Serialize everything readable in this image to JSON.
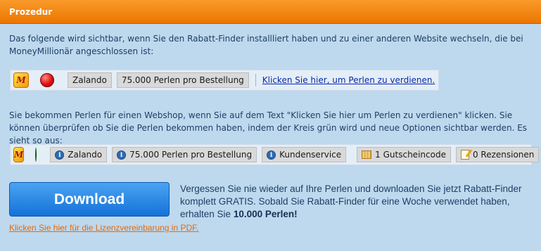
{
  "header": {
    "title": "Prozedur"
  },
  "intro_text": "Das folgende wird sichtbar, wenn Sie den Rabatt-Finder installliert haben und zu einer anderen Website wechseln, die bei MoneyMillionär angeschlossen ist:",
  "bar1": {
    "logo_text": "M",
    "status_color": "#e01010",
    "shop": "Zalando",
    "perlen": "75.000 Perlen pro Bestellung",
    "link": "Klicken Sie hier, um Perlen zu verdienen."
  },
  "explain_text": "Sie bekommen Perlen für einen Webshop, wenn Sie auf dem Text \"Klicken Sie hier um Perlen zu verdienen\" klicken. Sie können überprüfen ob Sie die Perlen bekommen haben, indem der Kreis grün wird und neue Optionen sichtbar werden. Es sieht so aus:",
  "bar2": {
    "logo_text": "M",
    "status_color": "#22c522",
    "shop": "Zalando",
    "perlen": "75.000 Perlen pro Bestellung",
    "service": "Kundenservice",
    "coupons": "1 Gutscheincode",
    "reviews": "0 Rezensionen"
  },
  "download": {
    "button_label": "Download",
    "promo_part1": "Vergessen Sie nie wieder auf Ihre Perlen und downloaden Sie jetzt Rabatt-Finder komplett GRATIS. Sobald Sie Rabatt-Finder für eine Woche verwendet haben, erhalten Sie ",
    "promo_bold": "10.000 Perlen!",
    "license_link": "Klicken Sie hier für die Lizenzvereinbarung in PDF."
  },
  "colors": {
    "header": "#f08a16",
    "background": "#bed8ee",
    "button": "#1f80e0",
    "link_orange": "#e56a08"
  },
  "icons": {
    "logo": "moneymillionaer-logo-icon",
    "status": "status-circle-icon",
    "info": "info-icon",
    "coupon": "coupon-icon",
    "review": "edit-icon"
  }
}
